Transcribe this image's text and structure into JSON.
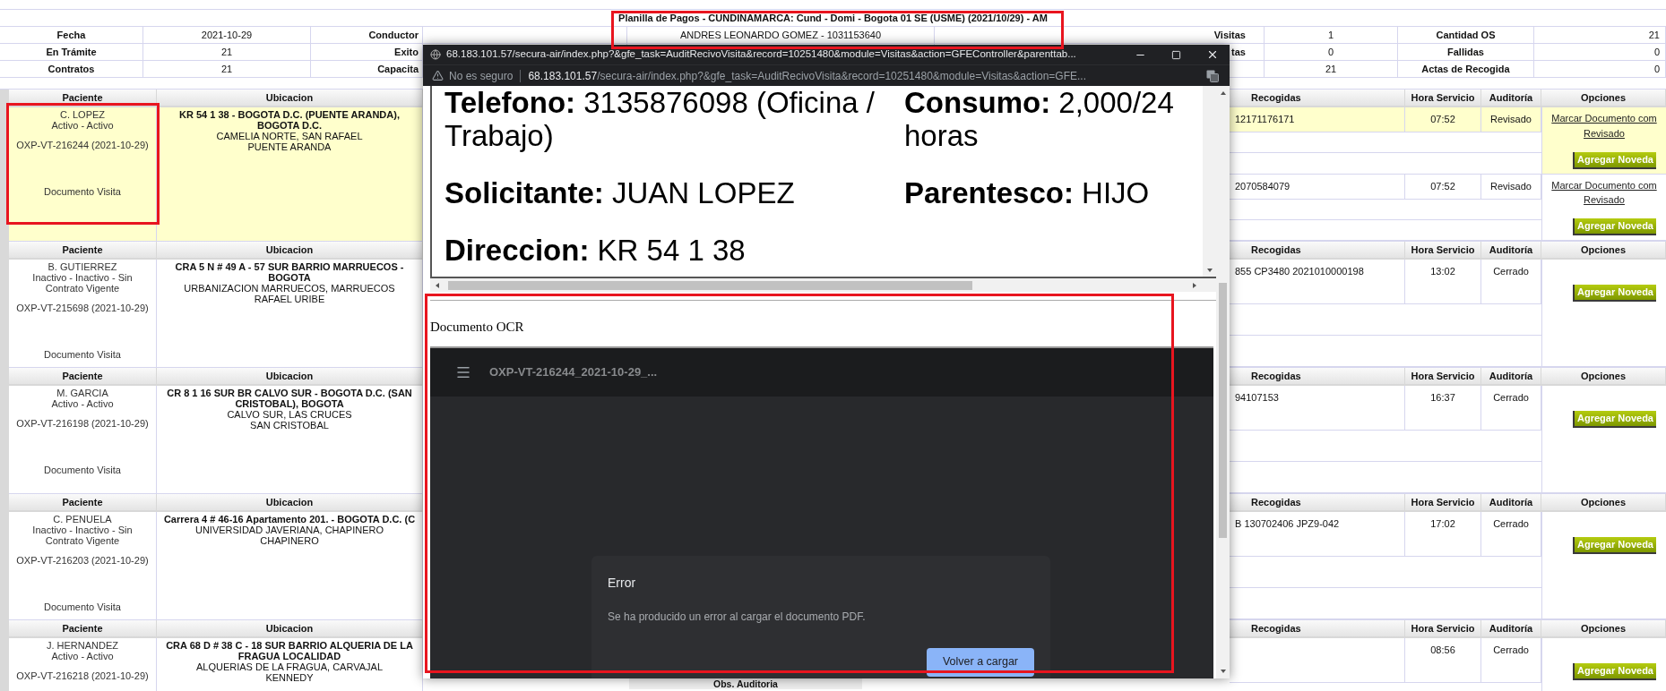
{
  "summary": {
    "title": "Planilla de Pagos - CUNDINAMARCA: Cund - Domi - Bogota 01 SE (USME) (2021/10/29) - AM",
    "rows": [
      {
        "label_1": "Fecha",
        "value_1": "2021-10-29",
        "label_2": "Conductor",
        "value_2": "ANDRES LEONARDO GOMEZ - 1031153640",
        "label_3": "Visitas",
        "value_3": "1",
        "label_4": "Cantidad OS",
        "value_4": "21"
      },
      {
        "label_1": "En Trámite",
        "value_1": "21",
        "label_2": "Exito",
        "label_3": "tas",
        "value_3": "0",
        "label_4": "Fallidas",
        "value_4": "0"
      },
      {
        "label_1": "Contratos",
        "value_1": "21",
        "label_2": "Capacita",
        "value_3": "21",
        "label_4": "Actas de Recogida",
        "value_4": "0"
      }
    ]
  },
  "blocks": [
    {
      "headers": [
        "Paciente",
        "Ubicacion",
        "Recogidas",
        "Hora Servicio",
        "Auditoría",
        "Opciones"
      ],
      "selected": true,
      "patient": "C. LOPEZ",
      "status": "Activo - Activo",
      "code": "OXP-VT-216244 (2021-10-29)",
      "document": "Documento Visita",
      "address": "KR 54 1 38 - BOGOTA D.C. (PUENTE ARANDA), BOGOTA D.C.",
      "address_lines": [
        "CAMELIA NORTE, SAN RAFAEL",
        "PUENTE ARANDA"
      ],
      "services": [
        {
          "selected": true,
          "recogidas": "12171176171",
          "hora": "07:52",
          "auditoria": "Revisado",
          "link_lines": [
            "Marcar Documento com",
            "Revisado"
          ],
          "button": "Agregar Noveda"
        },
        {
          "selected": false,
          "recogidas": "2070584079",
          "hora": "07:52",
          "auditoria": "Revisado",
          "link_lines": [
            "Marcar Documento com",
            "Revisado"
          ],
          "button": "Agregar Noveda"
        }
      ]
    },
    {
      "headers": [
        "Paciente",
        "Ubicacion",
        "Recogidas",
        "Hora Servicio",
        "Auditoría",
        "Opciones"
      ],
      "selected": false,
      "patient": "B. GUTIERREZ",
      "status": "Inactivo - Inactivo - Sin Contrato Vigente",
      "code": "OXP-VT-215698 (2021-10-29)",
      "document": "Documento Visita",
      "address": "CRA 5 N # 49 A - 57 SUR BARRIO MARRUECOS - BOGOTA",
      "address_lines": [
        "URBANIZACION MARRUECOS, MARRUECOS",
        "RAFAEL URIBE"
      ],
      "services": [
        {
          "selected": false,
          "recogidas": "855 CP3480 2021010000198",
          "hora": "13:02",
          "auditoria": "Cerrado",
          "button": "Agregar Noveda"
        }
      ]
    },
    {
      "headers": [
        "Paciente",
        "Ubicacion",
        "Recogidas",
        "Hora Servicio",
        "Auditoría",
        "Opciones"
      ],
      "selected": false,
      "patient": "M. GARCIA",
      "status": "Activo - Activo",
      "code": "OXP-VT-216198 (2021-10-29)",
      "document": "Documento Visita",
      "address": "CR 8 1 16 SUR BR CALVO SUR - BOGOTA D.C. (SAN CRISTOBAL), BOGOTA",
      "address_lines": [
        "CALVO SUR, LAS CRUCES",
        "SAN CRISTOBAL"
      ],
      "services": [
        {
          "selected": false,
          "recogidas": "94107153",
          "hora": "16:37",
          "auditoria": "Cerrado",
          "button": "Agregar Noveda"
        }
      ]
    },
    {
      "headers": [
        "Paciente",
        "Ubicacion",
        "Recogidas",
        "Hora Servicio",
        "Auditoría",
        "Opciones"
      ],
      "selected": false,
      "patient": "C. PENUELA",
      "status": "Inactivo - Inactivo - Sin Contrato Vigente",
      "code": "OXP-VT-216203 (2021-10-29)",
      "document": "Documento Visita",
      "address": "Carrera 4 # 46-16 Apartamento 201. - BOGOTA D.C. (C",
      "address_lines": [
        "UNIVERSIDAD JAVERIANA, CHAPINERO",
        "CHAPINERO"
      ],
      "services": [
        {
          "selected": false,
          "recogidas": "B 130702406 JPZ9-042",
          "hora": "17:02",
          "auditoria": "Cerrado",
          "button": "Agregar Noveda"
        }
      ]
    },
    {
      "headers": [
        "Paciente",
        "Ubicacion",
        "Recogidas",
        "Hora Servicio",
        "Auditoría",
        "Opciones"
      ],
      "selected": false,
      "patient": "J. HERNANDEZ",
      "status": "Activo - Activo",
      "code": "OXP-VT-216218 (2021-10-29)",
      "address": "CRA 68 D # 38 C - 18 SUR BARRIO ALQUERIA DE LA FRAGUA LOCALIDAD",
      "address_lines": [
        "ALQUERIAS DE LA FRAGUA, CARVAJAL",
        "KENNEDY"
      ],
      "observations_heading": "Obs. Auditoria",
      "services": [
        {
          "selected": false,
          "hora": "08:56",
          "auditoria": "Cerrado",
          "button": "Agregar Noveda"
        }
      ]
    }
  ],
  "popup": {
    "title": "68.183.101.57/secura-air/index.php?&gfe_task=AuditRecivoVisita&record=10251480&module=Visitas&action=GFEController&parenttab...",
    "security": "No es seguro",
    "url_host": "68.183.101.57",
    "url_path": "/secura-air/index.php?&gfe_task=AuditRecivoVisita&record=10251480&module=Visitas&action=GFE...",
    "details": [
      {
        "label": "Telefono:",
        "value": "3135876098 (Oficina / Trabajo)"
      },
      {
        "label": "Consumo:",
        "value": "2,000/24 horas"
      },
      {
        "label": "Solicitante:",
        "value": "JUAN LOPEZ"
      },
      {
        "label": "Parentesco:",
        "value": "HIJO"
      },
      {
        "label": "Direccion:",
        "value": "KR 54 1 38"
      }
    ],
    "ocr_heading": "Documento OCR",
    "viewer": {
      "file": "OXP-VT-216244_2021-10-29_...",
      "error_title": "Error",
      "error_message": "Se ha producido un error al cargar el documento PDF.",
      "reload_button": "Volver a cargar"
    }
  }
}
